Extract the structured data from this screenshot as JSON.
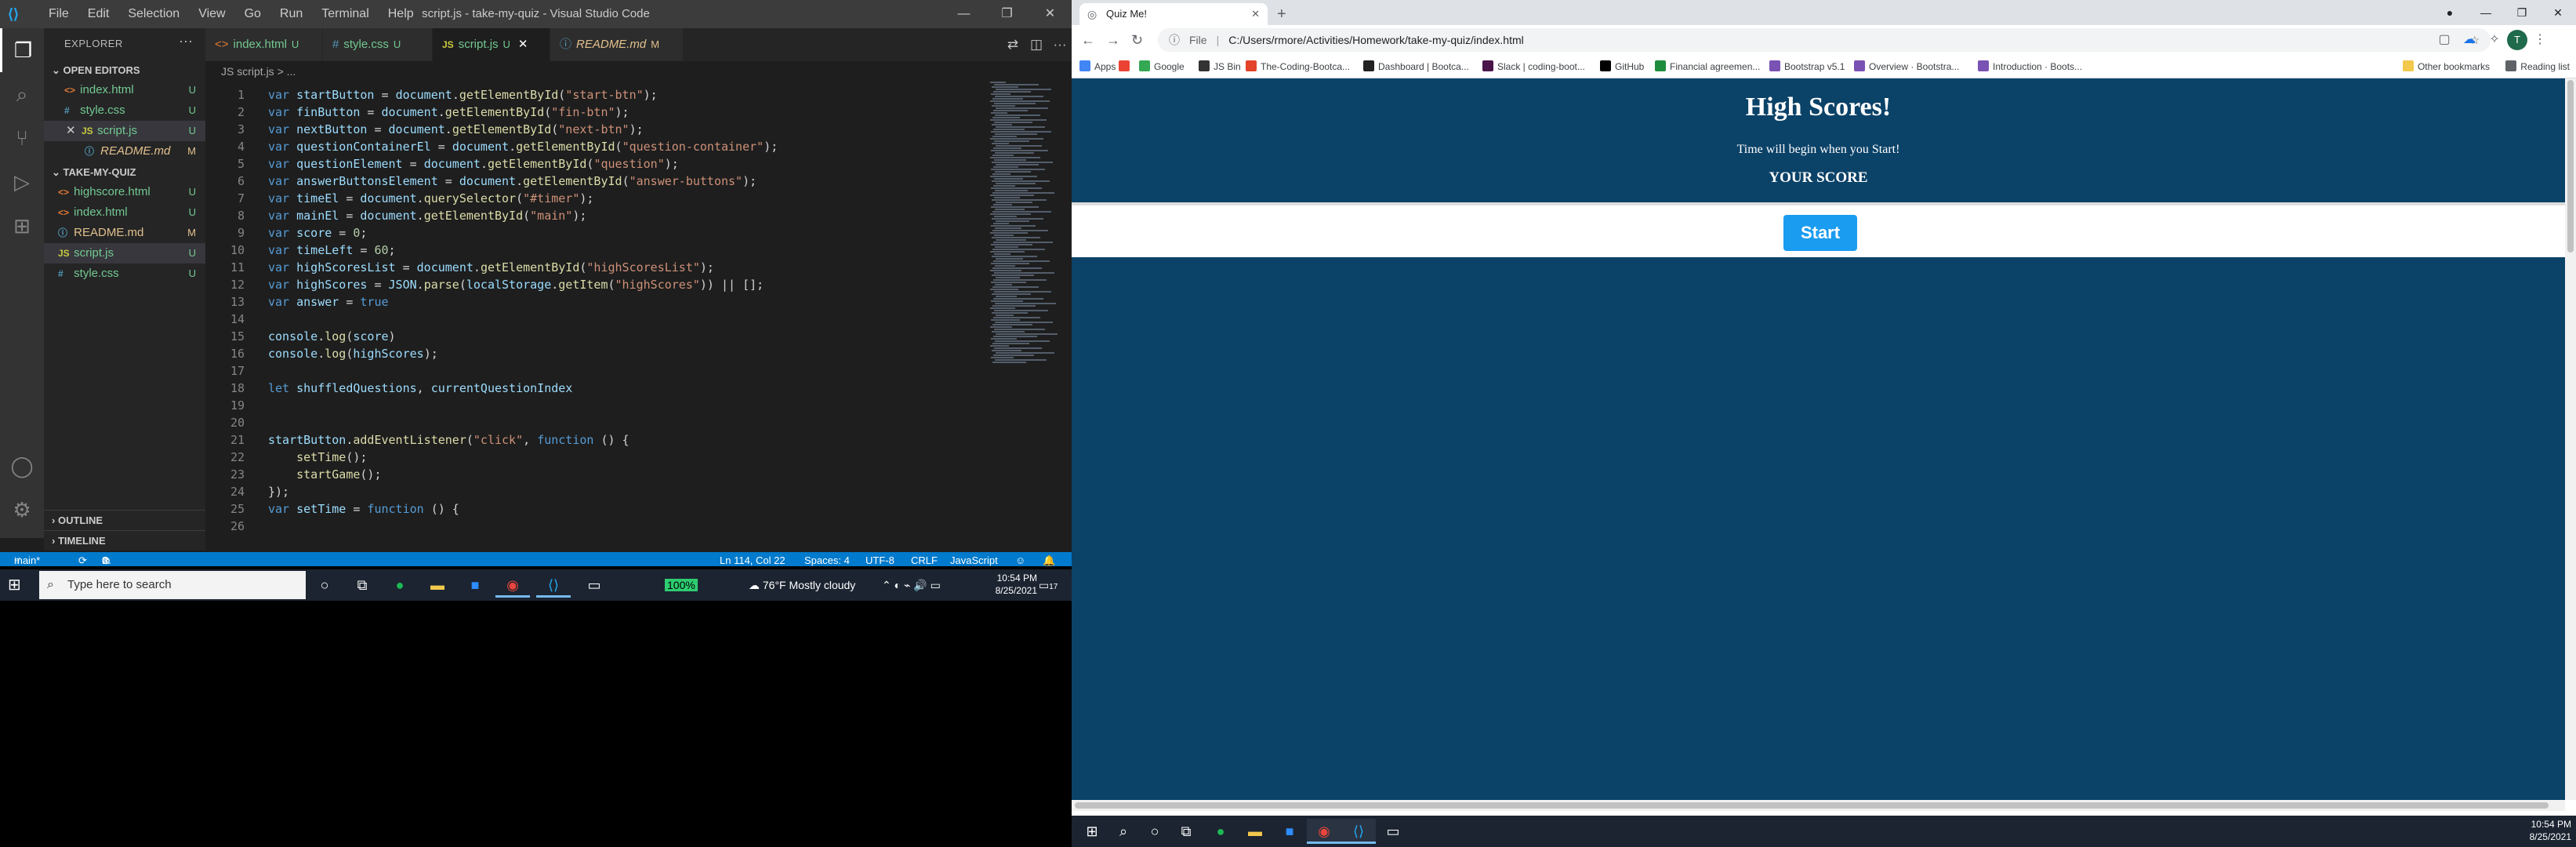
{
  "vscode": {
    "menu": [
      "File",
      "Edit",
      "Selection",
      "View",
      "Go",
      "Run",
      "Terminal",
      "Help"
    ],
    "window_title": "script.js - take-my-quiz - Visual Studio Code",
    "explorer_header": "EXPLORER",
    "open_editors_header": "OPEN EDITORS",
    "open_editors": [
      {
        "name": "index.html",
        "status": "U",
        "type": "html"
      },
      {
        "name": "style.css",
        "status": "U",
        "type": "css"
      },
      {
        "name": "script.js",
        "status": "U",
        "type": "js"
      },
      {
        "name": "README.md",
        "status": "M",
        "type": "info"
      }
    ],
    "folder_header": "TAKE-MY-QUIZ",
    "files": [
      {
        "name": "highscore.html",
        "status": "U",
        "type": "html"
      },
      {
        "name": "index.html",
        "status": "U",
        "type": "html"
      },
      {
        "name": "README.md",
        "status": "M",
        "type": "info"
      },
      {
        "name": "script.js",
        "status": "U",
        "type": "js"
      },
      {
        "name": "style.css",
        "status": "U",
        "type": "css"
      }
    ],
    "outline_label": "OUTLINE",
    "timeline_label": "TIMELINE",
    "tabs": [
      {
        "name": "index.html",
        "status": "U",
        "type": "html"
      },
      {
        "name": "style.css",
        "status": "U",
        "type": "css"
      },
      {
        "name": "script.js",
        "status": "U",
        "type": "js"
      },
      {
        "name": "README.md",
        "status": "M",
        "type": "info"
      }
    ],
    "breadcrumb": "JS script.js > ...",
    "code_lines": [
      "var startButton = document.getElementById(\"start-btn\");",
      "var finButton = document.getElementById(\"fin-btn\");",
      "var nextButton = document.getElementById(\"next-btn\");",
      "var questionContainerEl = document.getElementById(\"question-container\");",
      "var questionElement = document.getElementById(\"question\");",
      "var answerButtonsElement = document.getElementById(\"answer-buttons\");",
      "var timeEl = document.querySelector(\"#timer\");",
      "var mainEl = document.getElementById(\"main\");",
      "var score = 0;",
      "var timeLeft = 60;",
      "var highScoresList = document.getElementById(\"highScoresList\");",
      "var highScores = JSON.parse(localStorage.getItem(\"highScores\")) || [];",
      "var answer = true",
      "",
      "console.log(score)",
      "console.log(highScores);",
      "",
      "let shuffledQuestions, currentQuestionIndex",
      "",
      "",
      "startButton.addEventListener(\"click\", function () {",
      "    setTime();",
      "    startGame();",
      "});",
      "var setTime = function () {",
      ""
    ],
    "status": {
      "branch": "main*",
      "errors": "0",
      "warnings": "0",
      "position": "Ln 114, Col 22",
      "spaces": "Spaces: 4",
      "encoding": "UTF-8",
      "eol": "CRLF",
      "language": "JavaScript"
    }
  },
  "taskbar_left": {
    "search_placeholder": "Type here to search",
    "battery": "100%",
    "weather": "76°F  Mostly cloudy",
    "time": "10:54 PM",
    "date": "8/25/2021",
    "notifications": "17"
  },
  "chrome": {
    "tab_title": "Quiz Me!",
    "url_label": "File",
    "url": "C:/Users/rmore/Activities/Homework/take-my-quiz/index.html",
    "profile_initial": "T",
    "bookmarks": [
      {
        "label": "Apps",
        "color": "#4285f4"
      },
      {
        "label": "",
        "color": "#ea4335"
      },
      {
        "label": "Google",
        "color": "#34a853"
      },
      {
        "label": "JS Bin",
        "color": "#333333"
      },
      {
        "label": "The-Coding-Bootca...",
        "color": "#e24329"
      },
      {
        "label": "Dashboard | Bootca...",
        "color": "#222222"
      },
      {
        "label": "Slack | coding-boot...",
        "color": "#4a154b"
      },
      {
        "label": "GitHub",
        "color": "#000000"
      },
      {
        "label": "Financial agreemen...",
        "color": "#1e8e3e"
      },
      {
        "label": "Bootstrap v5.1",
        "color": "#7952b3"
      },
      {
        "label": "Overview · Bootstra...",
        "color": "#7952b3"
      },
      {
        "label": "Introduction · Boots...",
        "color": "#7952b3"
      }
    ],
    "other_bookmarks": "Other bookmarks",
    "reading_list": "Reading list",
    "page": {
      "heading": "High Scores!",
      "timer_text": "Time will begin when you Start!",
      "score_label": "YOUR SCORE",
      "start_button": "Start",
      "bg_color": "#0b4268",
      "button_color": "#1a9cf0"
    }
  },
  "taskbar_right": {
    "time": "10:54 PM",
    "date": "8/25/2021"
  }
}
